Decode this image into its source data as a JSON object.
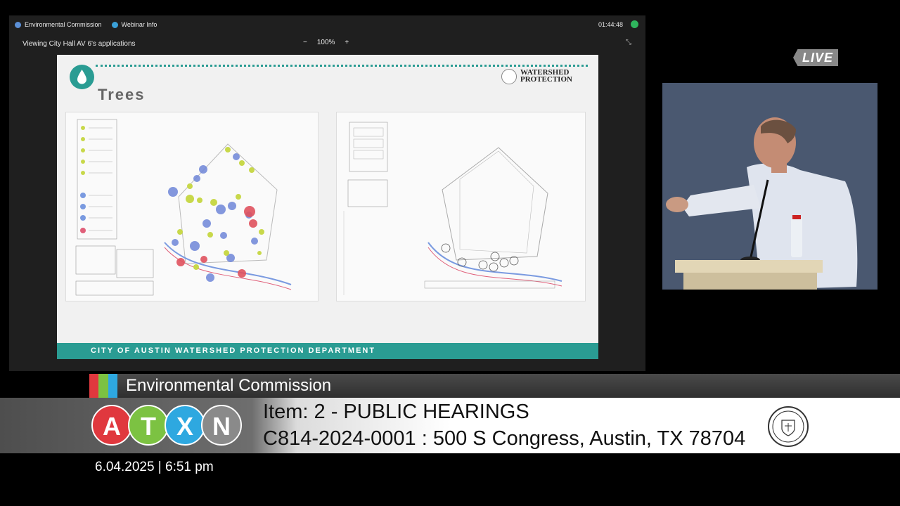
{
  "teams": {
    "meeting_title": "Environmental Commission",
    "webinar_label": "Webinar Info",
    "timer": "01:44:48",
    "viewing_label": "Viewing City Hall AV 6's applications",
    "zoom_level": "100%",
    "zoom_out": "−",
    "zoom_in": "+"
  },
  "slide": {
    "title": "Trees",
    "logo_line1": "WATERSHED",
    "logo_line2": "PROTECTION",
    "footer": "CITY OF AUSTIN WATERSHED PROTECTION DEPARTMENT"
  },
  "live_badge": "LIVE",
  "lower_third": {
    "commission": "Environmental Commission",
    "atxn_letters": [
      "A",
      "T",
      "X",
      "N"
    ],
    "item": "Item: 2 - PUBLIC HEARINGS",
    "address": "C814-2024-0001 : 500 S Congress, Austin, TX 78704",
    "datetime": "6.04.2025 | 6:51 pm"
  },
  "colors": {
    "teal": "#2a9c93",
    "atxn_a": "#e0383e",
    "atxn_t": "#7cc242",
    "atxn_x": "#2ea8e0",
    "atxn_n": "#8a8a8a",
    "stripe_red": "#e0383e",
    "stripe_green": "#7cc242",
    "stripe_blue": "#2ea8e0"
  }
}
